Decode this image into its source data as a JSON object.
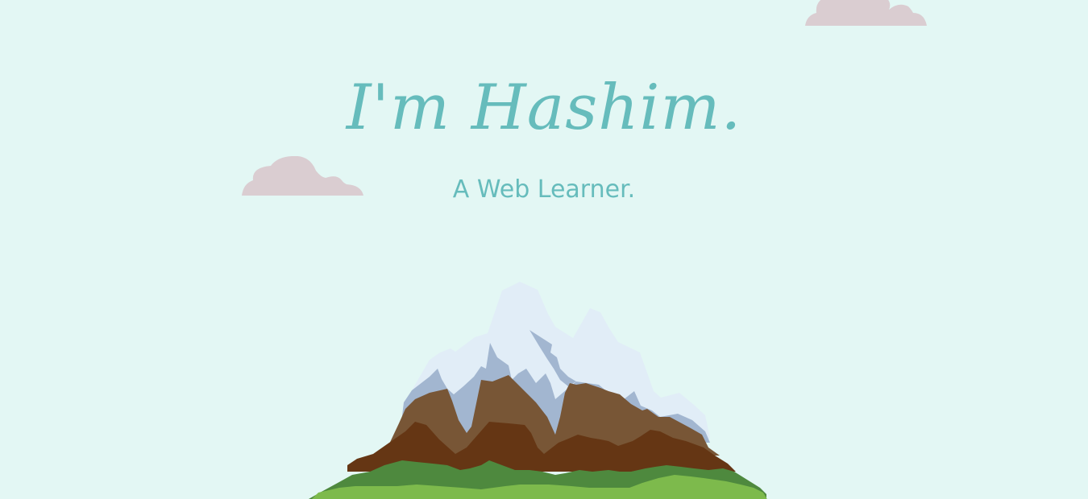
{
  "hero": {
    "title": "I'm Hashim.",
    "subtitle": "A Web Learner."
  },
  "colors": {
    "background": "#e3f7f4",
    "text": "#66bcbc",
    "cloud": "#dacdd1",
    "snow": "#e1edf7",
    "snow_shadow": "#a2b6d0",
    "rock_light": "#785636",
    "rock_dark": "#653614",
    "grass_dark": "#4e893e",
    "grass_light": "#7dba4c"
  },
  "icons": {
    "clouds": "cloud-icon",
    "illustration": "mountain-icon"
  }
}
